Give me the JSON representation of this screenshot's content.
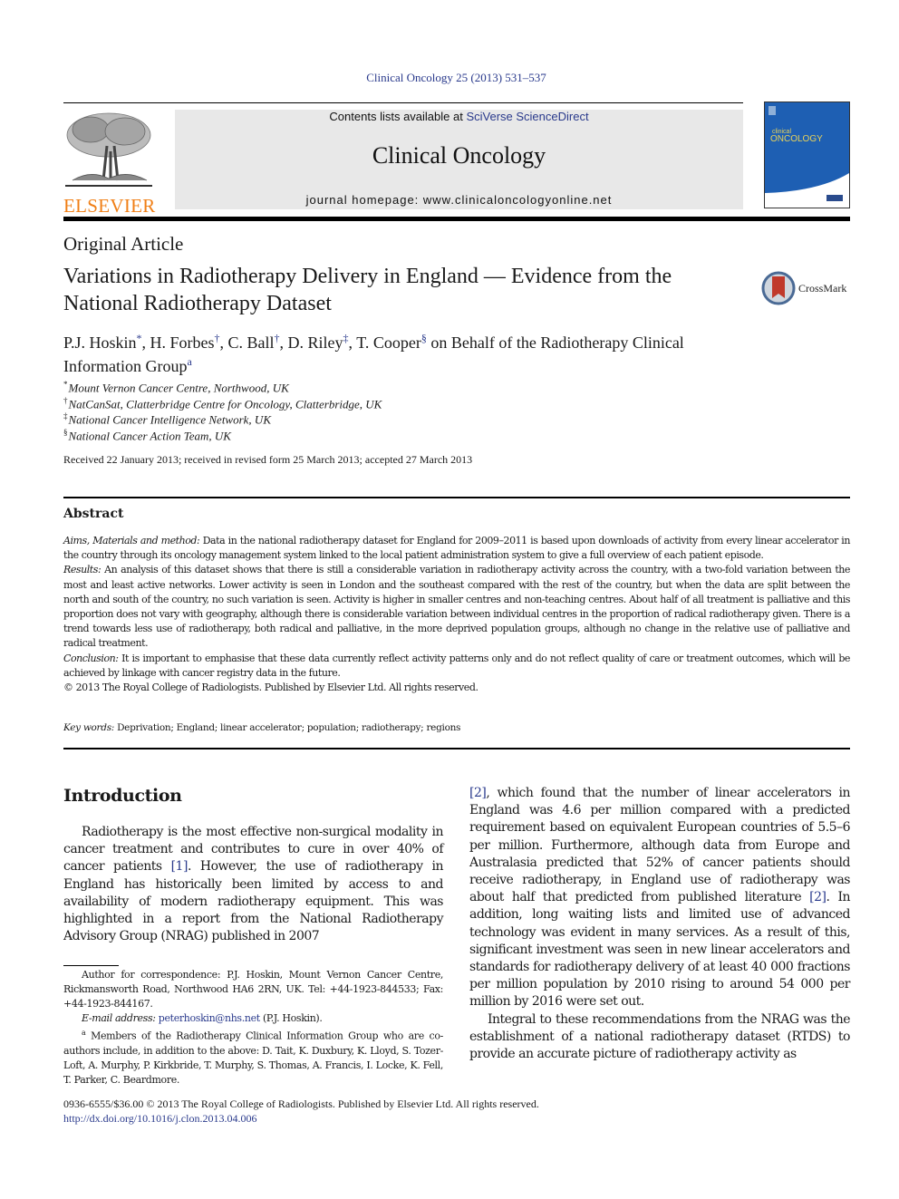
{
  "header": {
    "citation": "Clinical Oncology 25 (2013) 531–537",
    "contents_prefix": "Contents lists available at ",
    "contents_link": "SciVerse ScienceDirect",
    "journal_title": "Clinical Oncology",
    "homepage": "journal homepage: www.clinicaloncologyonline.net",
    "publisher_logo_text": "ELSEVIER",
    "cover_title_small": "clinical",
    "cover_title_large": "ONCOLOGY",
    "colors": {
      "elsevier_orange": "#f07f16",
      "link_blue": "#2a3a8c",
      "cover_blue": "#1e5fb3",
      "masthead_gray": "#e8e8e8"
    }
  },
  "article": {
    "type": "Original Article",
    "title": "Variations in Radiotherapy Delivery in England — Evidence from the National Radiotherapy Dataset",
    "crossmark_label": "CrossMark",
    "authors": [
      {
        "name": "P.J. Hoskin",
        "mark": "*"
      },
      {
        "name": "H. Forbes",
        "mark": "†"
      },
      {
        "name": "C. Ball",
        "mark": "†"
      },
      {
        "name": "D. Riley",
        "mark": "‡"
      },
      {
        "name": "T. Cooper",
        "mark": "§"
      }
    ],
    "group_prefix": " on Behalf of  the Radiotherapy Clinical Information Group",
    "group_mark": "a",
    "affiliations": [
      {
        "mark": "*",
        "text": "Mount Vernon Cancer Centre, Northwood, UK"
      },
      {
        "mark": "†",
        "text": "NatCanSat, Clatterbridge Centre for Oncology, Clatterbridge, UK"
      },
      {
        "mark": "‡",
        "text": "National Cancer Intelligence Network, UK"
      },
      {
        "mark": "§",
        "text": "National Cancer Action Team, UK"
      }
    ],
    "received": "Received 22 January 2013; received in revised form 25 March 2013; accepted 27 March 2013"
  },
  "abstract": {
    "heading": "Abstract",
    "aims_label": "Aims, Materials and method:",
    "aims_text": " Data in the national radiotherapy dataset for England for 2009–2011 is based upon downloads of activity from every linear accelerator in the country through its oncology management system linked to the local patient administration system to give a full overview of each patient episode.",
    "results_label": "Results:",
    "results_text": " An analysis of this dataset shows that there is still a considerable variation in radiotherapy activity across the country, with a two-fold variation between the most and least active networks. Lower activity is seen in London and the southeast compared with the rest of the country, but when the data are split between the north and south of the country, no such variation is seen. Activity is higher in smaller centres and non-teaching centres. About half of all treatment is palliative and this proportion does not vary with geography, although there is considerable variation between individual centres in the proportion of radical radiotherapy given. There is a trend towards less use of radiotherapy, both radical and palliative, in the more deprived population groups, although no change in the relative use of palliative and radical treatment.",
    "conclusion_label": "Conclusion:",
    "conclusion_text": " It is important to emphasise that these data currently reflect activity patterns only and do not reflect quality of care or treatment outcomes, which will be achieved by linkage with cancer registry data in the future.",
    "copyright": "© 2013 The Royal College of Radiologists. Published by Elsevier Ltd. All rights reserved.",
    "keywords_label": "Key words:",
    "keywords_text": " Deprivation; England; linear accelerator; population; radiotherapy; regions"
  },
  "introduction": {
    "heading": "Introduction",
    "p1_a": "Radiotherapy is the most effective non-surgical modality in cancer treatment and contributes to cure in over 40% of cancer patients ",
    "p1_ref1": "[1]",
    "p1_b": ". However, the use of radiotherapy in England has historically been limited by access to and availability of modern radiotherapy equipment. This was highlighted in a report from the National Radiotherapy Advisory Group (NRAG) published in 2007 ",
    "p1_ref2": "[2]",
    "p1_c": ", which found that the number of linear accelerators in England was 4.6 per million compared with a predicted requirement based on equivalent European countries of 5.5–6 per million. Furthermore, although data from Europe and Australasia predicted that 52% of cancer patients should receive radiotherapy, in England use of radiotherapy was about half that predicted from published literature ",
    "p1_ref3": "[2]",
    "p1_d": ". In addition, long waiting lists and limited use of advanced technology was evident in many services. As a result of this, significant investment was seen in new linear accelerators and standards for radiotherapy delivery of at least 40 000 fractions per million population by 2010 rising to around 54 000 per million by 2016 were set out.",
    "p2": "Integral to these recommendations from the NRAG was the establishment of a national radiotherapy dataset (RTDS) to provide an accurate picture of radiotherapy activity as"
  },
  "footnotes": {
    "corresponding": "Author for correspondence: P.J. Hoskin, Mount Vernon Cancer Centre, Rickmansworth Road, Northwood HA6 2RN, UK. Tel: +44-1923-844533; Fax: +44-1923-844167.",
    "email_label": "E-mail address:",
    "email": "peterhoskin@nhs.net",
    "email_suffix": " (P.J. Hoskin).",
    "group_mark": "a",
    "group_members": " Members of the Radiotherapy Clinical Information Group who are co-authors include, in addition to the above: D. Tait, K. Duxbury, K. Lloyd, S. Tozer-Loft, A. Murphy, P. Kirkbride, T. Murphy, S. Thomas, A. Francis, I. Locke, K. Fell, T. Parker, C. Beardmore."
  },
  "footer": {
    "issn_line": "0936-6555/$36.00 © 2013 The Royal College of Radiologists. Published by Elsevier Ltd. All rights reserved.",
    "doi": "http://dx.doi.org/10.1016/j.clon.2013.04.006"
  }
}
